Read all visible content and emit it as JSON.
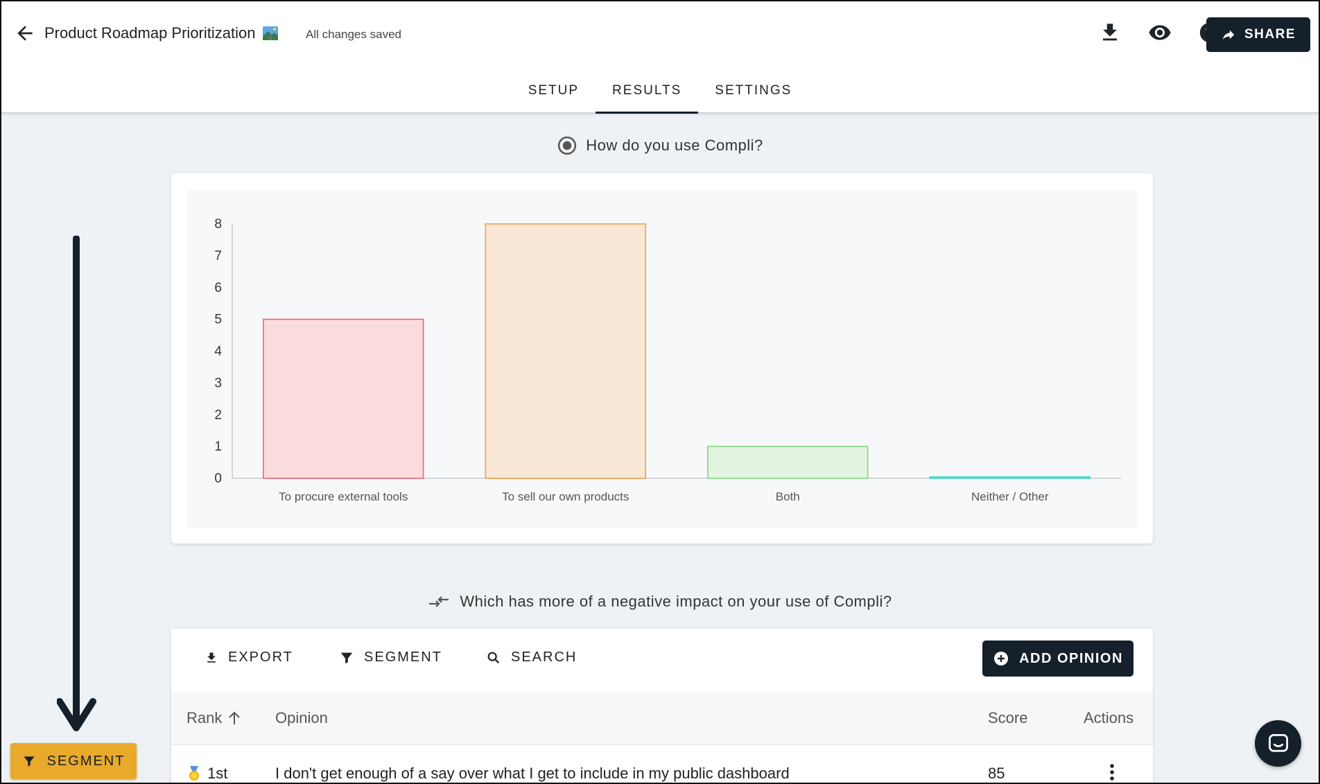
{
  "header": {
    "title": "Product Roadmap Prioritization",
    "title_emoji_icon": "roadmap-emoji-icon",
    "save_status": "All changes saved",
    "share_label": "SHARE"
  },
  "tabs": [
    {
      "label": "SETUP",
      "active": false
    },
    {
      "label": "RESULTS",
      "active": true
    },
    {
      "label": "SETTINGS",
      "active": false
    }
  ],
  "question1": {
    "icon": "radio-button-icon",
    "text": "How do you use Compli?"
  },
  "chart_data": {
    "type": "bar",
    "title": "",
    "xlabel": "",
    "ylabel": "",
    "ylim": [
      0,
      8
    ],
    "yticks": [
      "0",
      "1",
      "2",
      "3",
      "4",
      "5",
      "6",
      "7",
      "8"
    ],
    "categories": [
      "To procure external tools",
      "To sell our own products",
      "Both",
      "Neither / Other"
    ],
    "values": [
      5,
      8,
      1,
      0
    ],
    "colors": {
      "fill": [
        "#fadcdf",
        "#fae8d7",
        "#e3f5e0",
        "#d9f5f1"
      ],
      "stroke": [
        "#ef6f7c",
        "#f2a65a",
        "#8fd98a",
        "#4fd3c4"
      ]
    },
    "grid": false,
    "legend": "none"
  },
  "question2": {
    "icon": "compare-arrows-icon",
    "text": "Which has more of a negative impact on your use of Compli?"
  },
  "toolbar": {
    "export_label": "EXPORT",
    "segment_label": "SEGMENT",
    "search_label": "SEARCH",
    "add_label": "ADD OPINION"
  },
  "table": {
    "headers": {
      "rank": "Rank",
      "opinion": "Opinion",
      "score": "Score",
      "actions": "Actions"
    },
    "rows": [
      {
        "medal_icon": "gold-medal-icon",
        "rank": "1st",
        "opinion": "I don't get enough of a say over what I get to include in my public dashboard",
        "score": "85"
      }
    ]
  },
  "floating": {
    "segment_label": "SEGMENT"
  },
  "colors": {
    "primary": "#15202b",
    "accent": "#e9a92b",
    "background": "#eef2f5"
  }
}
